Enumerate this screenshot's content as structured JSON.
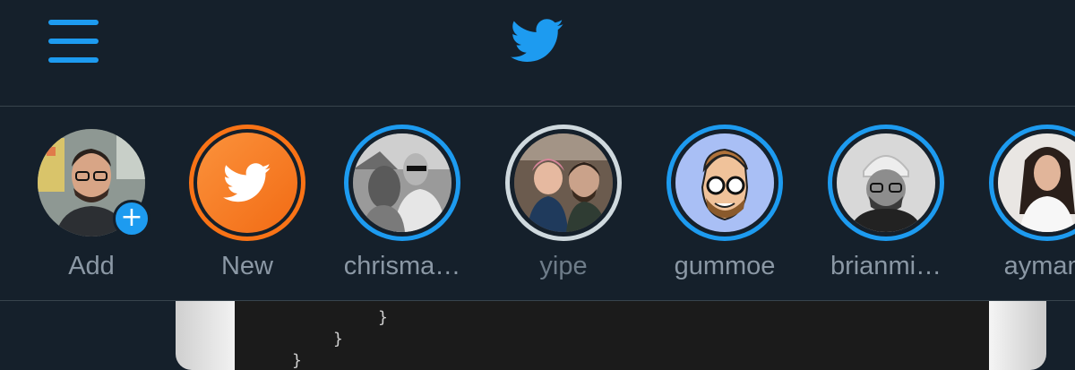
{
  "header": {
    "menu_icon": "hamburger-menu-icon",
    "logo_icon": "twitter-bird-icon"
  },
  "colors": {
    "background": "#15202b",
    "accent": "#1d9bf0",
    "new_orange": "#f97316",
    "seen_ring": "#cfd9de",
    "label": "#8b98a5"
  },
  "stories": [
    {
      "label": "Add",
      "ring": "none",
      "badge": "+"
    },
    {
      "label": "New",
      "ring": "orange"
    },
    {
      "label": "chrisma…",
      "ring": "unseen"
    },
    {
      "label": "yipe",
      "ring": "seen"
    },
    {
      "label": "gummoe",
      "ring": "unseen"
    },
    {
      "label": "brianmi…",
      "ring": "unseen"
    },
    {
      "label": "aymanr",
      "ring": "unseen"
    }
  ]
}
